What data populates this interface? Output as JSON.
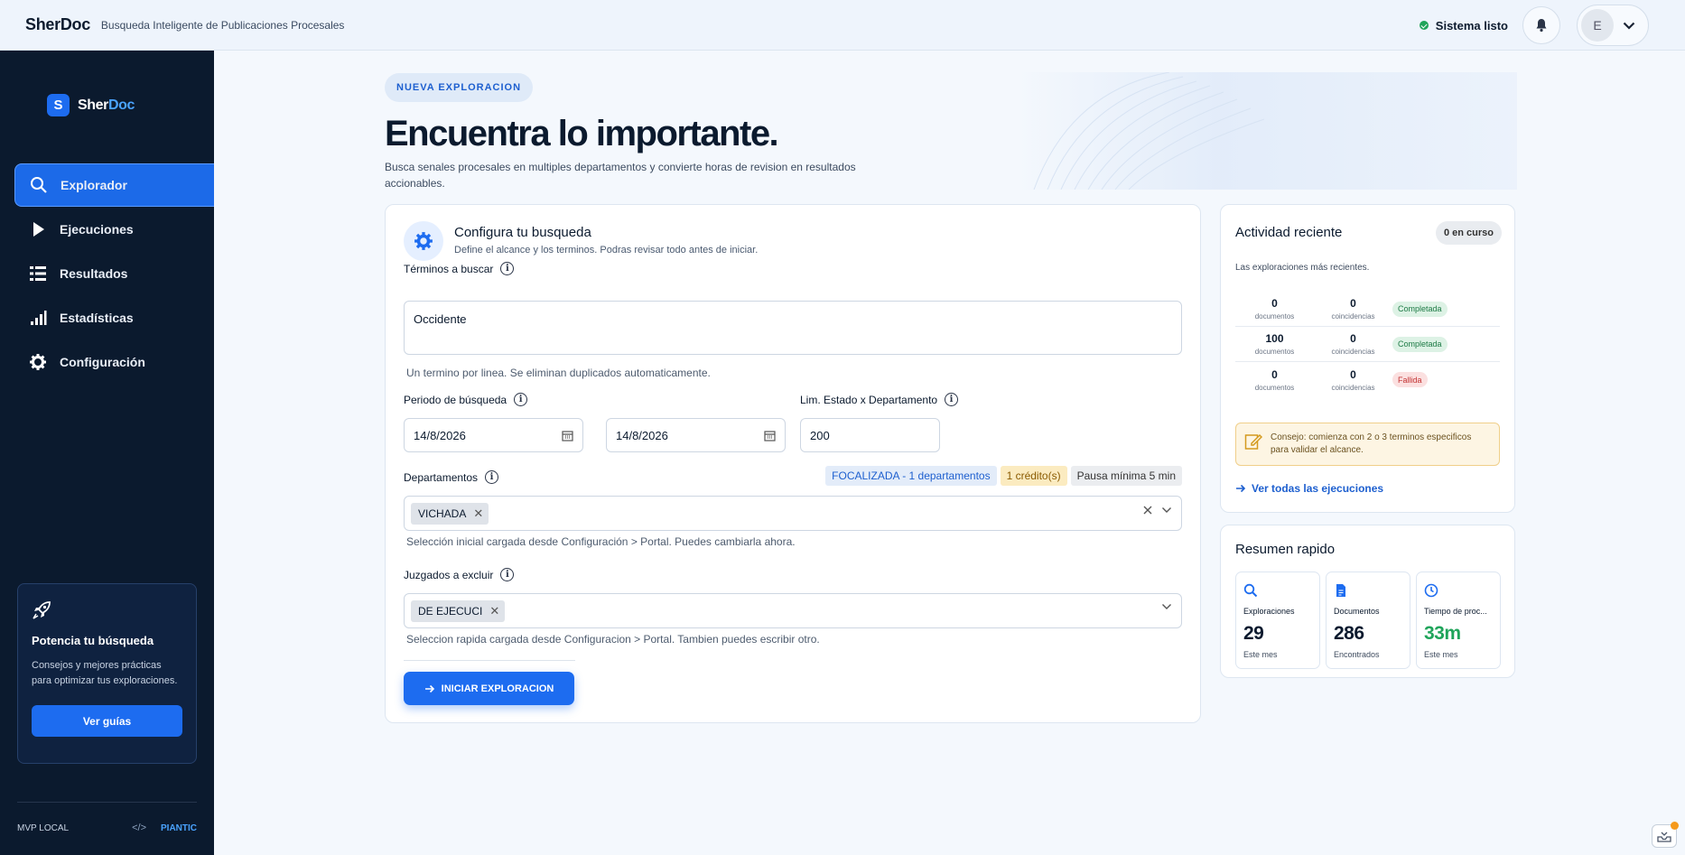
{
  "header": {
    "brand": "SherDoc",
    "subtitle": "Busqueda Inteligente de Publicaciones Procesales",
    "status": "Sistema listo",
    "user_initial": "E"
  },
  "sidebar": {
    "logo_letter": "S",
    "logo_part1": "Sher",
    "logo_part2": "Doc",
    "items": [
      {
        "label": "Explorador",
        "icon": "search-icon",
        "active": true
      },
      {
        "label": "Ejecuciones",
        "icon": "play-icon"
      },
      {
        "label": "Resultados",
        "icon": "list-icon"
      },
      {
        "label": "Estadísticas",
        "icon": "bar-chart-icon"
      },
      {
        "label": "Configuración",
        "icon": "gear-icon"
      }
    ],
    "promo": {
      "title": "Potencia tu búsqueda",
      "text": "Consejos y mejores prácticas para optimizar tus exploraciones.",
      "button": "Ver guías"
    },
    "footer_left": "MVP LOCAL",
    "footer_right": "PIANTIC"
  },
  "main": {
    "pill": "NUEVA EXPLORACION",
    "title": "Encuentra lo importante.",
    "subtitle": "Busca senales procesales en multiples departamentos y convierte horas de revision en resultados accionables."
  },
  "config": {
    "title": "Configura tu busqueda",
    "subtitle": "Define el alcance y los terminos. Podras revisar todo antes de iniciar.",
    "terms_label": "Términos a buscar",
    "terms_value": "Occidente",
    "terms_help": "Un termino por linea. Se eliminan duplicados automaticamente.",
    "period_label": "Periodo de búsqueda",
    "date_from": "14/8/2026",
    "date_to": "14/8/2026",
    "limit_label": "Lim. Estado x Departamento",
    "limit_value": "200",
    "departments_label": "Departamentos",
    "badge_focus": "FOCALIZADA - 1 departamentos",
    "badge_credit": "1 crédito(s)",
    "badge_pause": "Pausa mínima 5 min",
    "department_chip": "VICHADA",
    "departments_help": "Selección inicial cargada desde Configuración > Portal. Puedes cambiarla ahora.",
    "exclude_label": "Juzgados a excluir",
    "exclude_chip": "DE EJECUCI",
    "exclude_help": "Seleccion rapida cargada desde Configuracion > Portal. Tambien puedes escribir otro.",
    "start_button": "INICIAR EXPLORACION"
  },
  "activity": {
    "title": "Actividad reciente",
    "running": "0 en curso",
    "subtitle": "Las exploraciones más recientes.",
    "unit_docs": "documentos",
    "unit_matches": "coincidencias",
    "rows": [
      {
        "docs": "0",
        "matches": "0",
        "status": "Completada"
      },
      {
        "docs": "100",
        "matches": "0",
        "status": "Completada"
      },
      {
        "docs": "0",
        "matches": "0",
        "status": "Fallida"
      }
    ],
    "tip": "Consejo: comienza con 2 o 3 terminos especificos para validar el alcance.",
    "link": "Ver todas las ejecuciones"
  },
  "summary": {
    "title": "Resumen rapido",
    "stats": [
      {
        "label": "Exploraciones",
        "value": "29",
        "period": "Este mes",
        "icon": "search-icon"
      },
      {
        "label": "Documentos",
        "value": "286",
        "period": "Encontrados",
        "icon": "document-icon"
      },
      {
        "label": "Tiempo de proc...",
        "value": "33m",
        "period": "Este mes",
        "icon": "clock-icon"
      }
    ]
  },
  "colors": {
    "accent": "#1d6cf0",
    "sidebar_bg": "#0b1a2e",
    "success": "#1fa45a",
    "danger": "#c23131"
  }
}
